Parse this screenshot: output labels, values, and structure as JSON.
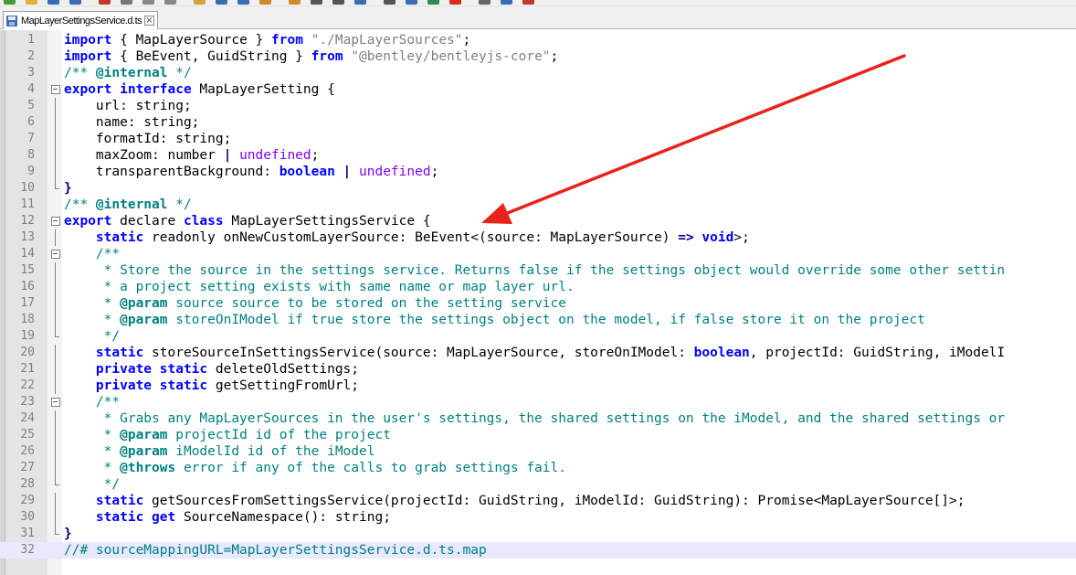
{
  "tab": {
    "label": "MapLayerSettingsService.d.ts",
    "close_glyph": "×"
  },
  "current_line": 32,
  "lines": [
    {
      "n": "1",
      "fold": "",
      "tokens": [
        [
          "kw",
          "import"
        ],
        [
          "id",
          " { MapLayerSource } "
        ],
        [
          "kw",
          "from"
        ],
        [
          "id",
          " "
        ],
        [
          "str",
          "\"./MapLayerSources\""
        ],
        [
          "id",
          ";"
        ]
      ]
    },
    {
      "n": "2",
      "fold": "",
      "tokens": [
        [
          "kw",
          "import"
        ],
        [
          "id",
          " { BeEvent, GuidString } "
        ],
        [
          "kw",
          "from"
        ],
        [
          "id",
          " "
        ],
        [
          "str",
          "\"@bentley/bentleyjs-core\""
        ],
        [
          "id",
          ";"
        ]
      ]
    },
    {
      "n": "3",
      "fold": "",
      "tokens": [
        [
          "cmt",
          "/** "
        ],
        [
          "tag",
          "@internal"
        ],
        [
          "cmt",
          " */"
        ]
      ]
    },
    {
      "n": "4",
      "fold": "box",
      "tokens": [
        [
          "kw",
          "export interface"
        ],
        [
          "id",
          " MapLayerSetting {"
        ]
      ]
    },
    {
      "n": "5",
      "fold": "line",
      "tokens": [
        [
          "id",
          "    url: string;"
        ]
      ]
    },
    {
      "n": "6",
      "fold": "line",
      "tokens": [
        [
          "id",
          "    name: string;"
        ]
      ]
    },
    {
      "n": "7",
      "fold": "line",
      "tokens": [
        [
          "id",
          "    formatId: string;"
        ]
      ]
    },
    {
      "n": "8",
      "fold": "line",
      "tokens": [
        [
          "id",
          "    maxZoom: number "
        ],
        [
          "op",
          "|"
        ],
        [
          "id",
          " "
        ],
        [
          "ty",
          "undefined"
        ],
        [
          "id",
          ";"
        ]
      ]
    },
    {
      "n": "9",
      "fold": "line",
      "tokens": [
        [
          "id",
          "    transparentBackground: "
        ],
        [
          "kw",
          "boolean"
        ],
        [
          "id",
          " "
        ],
        [
          "op",
          "|"
        ],
        [
          "id",
          " "
        ],
        [
          "ty",
          "undefined"
        ],
        [
          "id",
          ";"
        ]
      ]
    },
    {
      "n": "10",
      "fold": "end",
      "tokens": [
        [
          "op",
          "}"
        ]
      ]
    },
    {
      "n": "11",
      "fold": "",
      "tokens": [
        [
          "cmt",
          "/** "
        ],
        [
          "tag",
          "@internal"
        ],
        [
          "cmt",
          " */"
        ]
      ]
    },
    {
      "n": "12",
      "fold": "box",
      "tokens": [
        [
          "kw",
          "export"
        ],
        [
          "id",
          " declare "
        ],
        [
          "kw",
          "class"
        ],
        [
          "id",
          " MapLayerSettingsService {"
        ]
      ]
    },
    {
      "n": "13",
      "fold": "line",
      "tokens": [
        [
          "id",
          "    "
        ],
        [
          "kw",
          "static"
        ],
        [
          "id",
          " readonly onNewCustomLayerSource: BeEvent<(source: MapLayerSource) "
        ],
        [
          "op",
          "=>"
        ],
        [
          "id",
          " "
        ],
        [
          "kw",
          "void"
        ],
        [
          "id",
          ">;"
        ]
      ]
    },
    {
      "n": "14",
      "fold": "box",
      "tokens": [
        [
          "id",
          "    "
        ],
        [
          "cmt",
          "/**"
        ]
      ]
    },
    {
      "n": "15",
      "fold": "line",
      "tokens": [
        [
          "cmt",
          "     * Store the source in the settings service. Returns false if the settings object would override some other settin"
        ]
      ]
    },
    {
      "n": "16",
      "fold": "line",
      "tokens": [
        [
          "cmt",
          "     * a project setting exists with same name or map layer url."
        ]
      ]
    },
    {
      "n": "17",
      "fold": "line",
      "tokens": [
        [
          "cmt",
          "     * "
        ],
        [
          "tag",
          "@param"
        ],
        [
          "cmt",
          " source source to be stored on the setting service"
        ]
      ]
    },
    {
      "n": "18",
      "fold": "line",
      "tokens": [
        [
          "cmt",
          "     * "
        ],
        [
          "tag",
          "@param"
        ],
        [
          "cmt",
          " storeOnIModel if true store the settings object on the model, if false store it on the project"
        ]
      ]
    },
    {
      "n": "19",
      "fold": "end",
      "tokens": [
        [
          "cmt",
          "     */"
        ]
      ]
    },
    {
      "n": "20",
      "fold": "line",
      "tokens": [
        [
          "id",
          "    "
        ],
        [
          "kw",
          "static"
        ],
        [
          "id",
          " storeSourceInSettingsService(source: MapLayerSource, storeOnIModel: "
        ],
        [
          "kw",
          "boolean"
        ],
        [
          "id",
          ", projectId: GuidString, iModelI"
        ]
      ]
    },
    {
      "n": "21",
      "fold": "line",
      "tokens": [
        [
          "id",
          "    "
        ],
        [
          "kw",
          "private static"
        ],
        [
          "id",
          " deleteOldSettings;"
        ]
      ]
    },
    {
      "n": "22",
      "fold": "line",
      "tokens": [
        [
          "id",
          "    "
        ],
        [
          "kw",
          "private static"
        ],
        [
          "id",
          " getSettingFromUrl;"
        ]
      ]
    },
    {
      "n": "23",
      "fold": "box",
      "tokens": [
        [
          "id",
          "    "
        ],
        [
          "cmt",
          "/**"
        ]
      ]
    },
    {
      "n": "24",
      "fold": "line",
      "tokens": [
        [
          "cmt",
          "     * Grabs any MapLayerSources in the user's settings, the shared settings on the iModel, and the shared settings or"
        ]
      ]
    },
    {
      "n": "25",
      "fold": "line",
      "tokens": [
        [
          "cmt",
          "     * "
        ],
        [
          "tag",
          "@param"
        ],
        [
          "cmt",
          " projectId id of the project"
        ]
      ]
    },
    {
      "n": "26",
      "fold": "line",
      "tokens": [
        [
          "cmt",
          "     * "
        ],
        [
          "tag",
          "@param"
        ],
        [
          "cmt",
          " iModelId id of the iModel"
        ]
      ]
    },
    {
      "n": "27",
      "fold": "line",
      "tokens": [
        [
          "cmt",
          "     * "
        ],
        [
          "tag",
          "@throws"
        ],
        [
          "cmt",
          " error if any of the calls to grab settings fail."
        ]
      ]
    },
    {
      "n": "28",
      "fold": "end",
      "tokens": [
        [
          "cmt",
          "     */"
        ]
      ]
    },
    {
      "n": "29",
      "fold": "line",
      "tokens": [
        [
          "id",
          "    "
        ],
        [
          "kw",
          "static"
        ],
        [
          "id",
          " getSourcesFromSettingsService(projectId: GuidString, iModelId: GuidString): Promise<MapLayerSource[]>;"
        ]
      ]
    },
    {
      "n": "30",
      "fold": "line",
      "tokens": [
        [
          "id",
          "    "
        ],
        [
          "kw",
          "static get"
        ],
        [
          "id",
          " SourceNamespace(): string;"
        ]
      ]
    },
    {
      "n": "31",
      "fold": "end",
      "tokens": [
        [
          "op",
          "}"
        ]
      ]
    },
    {
      "n": "32",
      "fold": "",
      "tokens": [
        [
          "cmt",
          "//# sourceMappingURL=MapLayerSettingsService.d.ts.map"
        ]
      ]
    }
  ],
  "colors": {
    "keyword": "#0000ff",
    "comment": "#008080",
    "string": "#808080",
    "type": "#8000ff",
    "arrow": "#e8231c",
    "current_line": "#e8e8ff"
  },
  "toolbar_icons": [
    "new-file-icon",
    "open-folder-icon",
    "save-icon",
    "save-all-icon",
    "close-icon",
    "print-icon",
    "cut-icon",
    "copy-icon",
    "paste-icon",
    "undo-icon",
    "redo-icon",
    "find-icon",
    "replace-icon",
    "zoom-in-icon",
    "zoom-out-icon",
    "sync-icon",
    "wrap-icon",
    "indent-icon",
    "bookmark-icon",
    "macro-record-icon",
    "macro-stop-icon",
    "macro-play-icon",
    "spellcheck-icon"
  ]
}
